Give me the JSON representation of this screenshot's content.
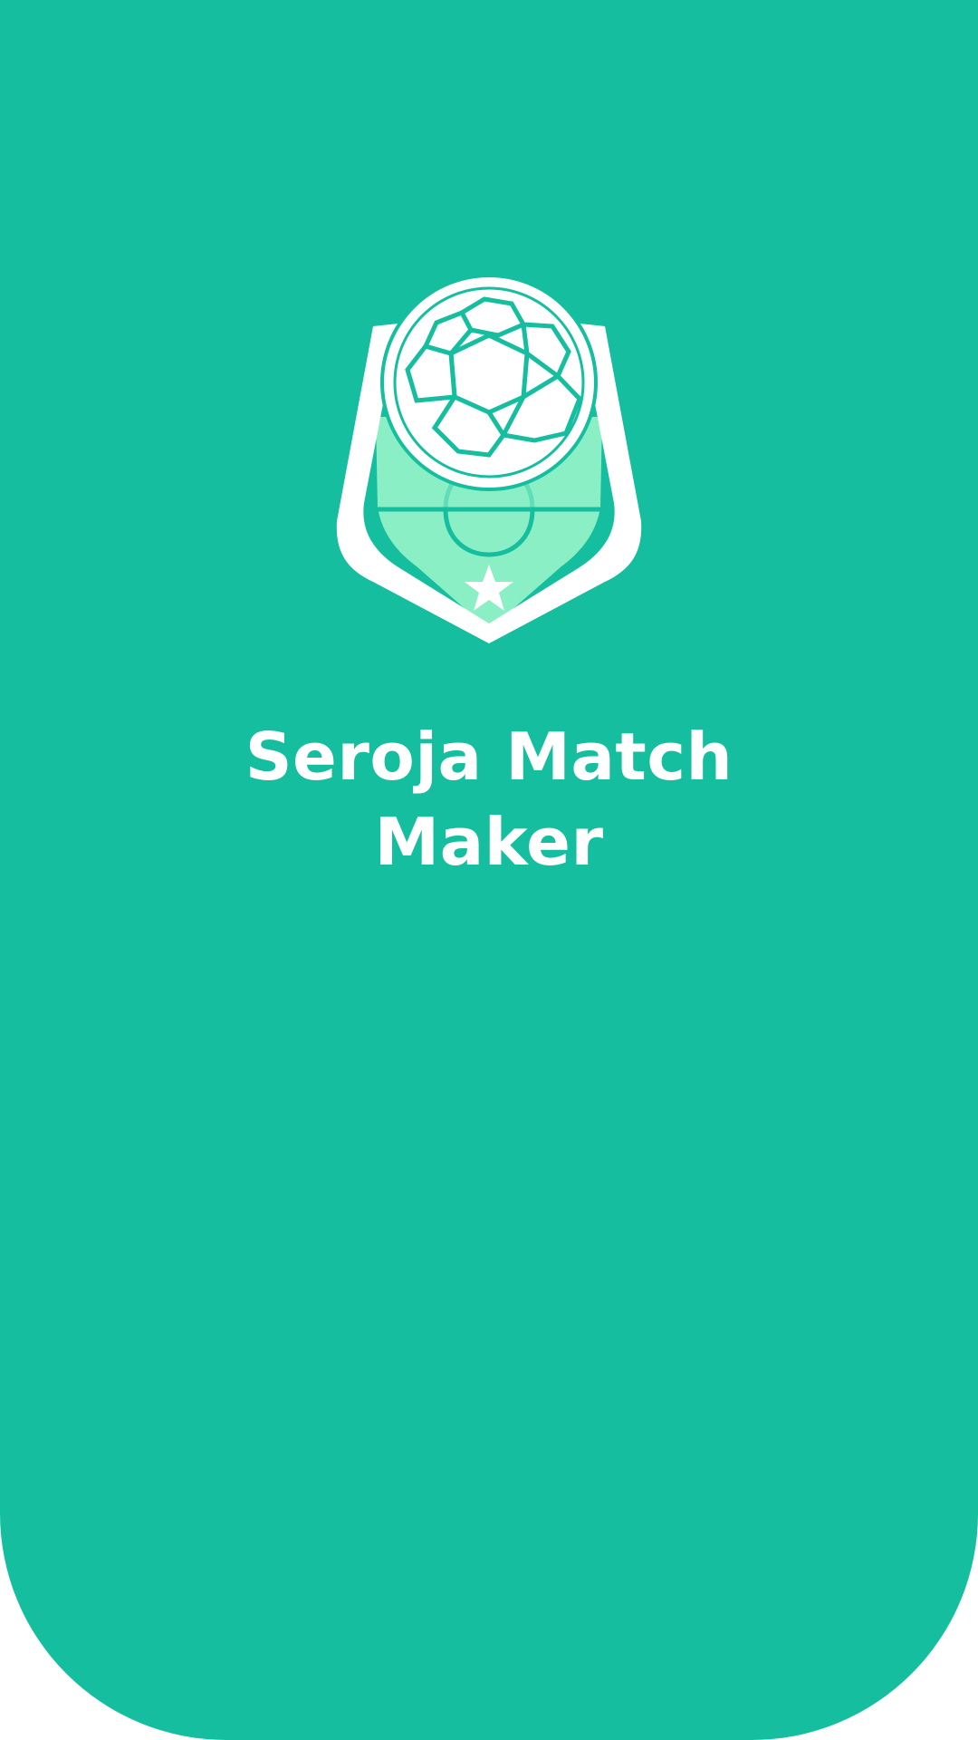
{
  "app": {
    "title": "Seroja Match Maker"
  },
  "colors": {
    "background": "#14BE9E",
    "logo_white": "#FFFFFF",
    "logo_field": "#8BEFC6",
    "logo_field_line": "#14BE9E"
  },
  "icons": {
    "logo": "soccer-ball-shield-icon"
  }
}
